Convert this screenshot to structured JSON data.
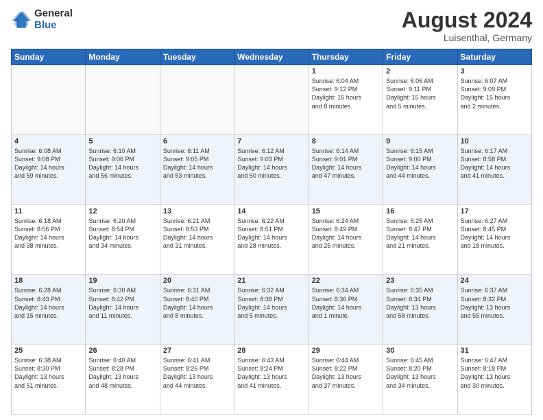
{
  "logo": {
    "general": "General",
    "blue": "Blue"
  },
  "title": "August 2024",
  "location": "Luisenthal, Germany",
  "days_header": [
    "Sunday",
    "Monday",
    "Tuesday",
    "Wednesday",
    "Thursday",
    "Friday",
    "Saturday"
  ],
  "weeks": [
    [
      {
        "day": "",
        "info": ""
      },
      {
        "day": "",
        "info": ""
      },
      {
        "day": "",
        "info": ""
      },
      {
        "day": "",
        "info": ""
      },
      {
        "day": "1",
        "info": "Sunrise: 6:04 AM\nSunset: 9:12 PM\nDaylight: 15 hours\nand 8 minutes."
      },
      {
        "day": "2",
        "info": "Sunrise: 6:06 AM\nSunset: 9:11 PM\nDaylight: 15 hours\nand 5 minutes."
      },
      {
        "day": "3",
        "info": "Sunrise: 6:07 AM\nSunset: 9:09 PM\nDaylight: 15 hours\nand 2 minutes."
      }
    ],
    [
      {
        "day": "4",
        "info": "Sunrise: 6:08 AM\nSunset: 9:08 PM\nDaylight: 14 hours\nand 59 minutes."
      },
      {
        "day": "5",
        "info": "Sunrise: 6:10 AM\nSunset: 9:06 PM\nDaylight: 14 hours\nand 56 minutes."
      },
      {
        "day": "6",
        "info": "Sunrise: 6:11 AM\nSunset: 9:05 PM\nDaylight: 14 hours\nand 53 minutes."
      },
      {
        "day": "7",
        "info": "Sunrise: 6:12 AM\nSunset: 9:03 PM\nDaylight: 14 hours\nand 50 minutes."
      },
      {
        "day": "8",
        "info": "Sunrise: 6:14 AM\nSunset: 9:01 PM\nDaylight: 14 hours\nand 47 minutes."
      },
      {
        "day": "9",
        "info": "Sunrise: 6:15 AM\nSunset: 9:00 PM\nDaylight: 14 hours\nand 44 minutes."
      },
      {
        "day": "10",
        "info": "Sunrise: 6:17 AM\nSunset: 8:58 PM\nDaylight: 14 hours\nand 41 minutes."
      }
    ],
    [
      {
        "day": "11",
        "info": "Sunrise: 6:18 AM\nSunset: 8:56 PM\nDaylight: 14 hours\nand 38 minutes."
      },
      {
        "day": "12",
        "info": "Sunrise: 6:20 AM\nSunset: 8:54 PM\nDaylight: 14 hours\nand 34 minutes."
      },
      {
        "day": "13",
        "info": "Sunrise: 6:21 AM\nSunset: 8:53 PM\nDaylight: 14 hours\nand 31 minutes."
      },
      {
        "day": "14",
        "info": "Sunrise: 6:22 AM\nSunset: 8:51 PM\nDaylight: 14 hours\nand 28 minutes."
      },
      {
        "day": "15",
        "info": "Sunrise: 6:24 AM\nSunset: 8:49 PM\nDaylight: 14 hours\nand 25 minutes."
      },
      {
        "day": "16",
        "info": "Sunrise: 6:25 AM\nSunset: 8:47 PM\nDaylight: 14 hours\nand 21 minutes."
      },
      {
        "day": "17",
        "info": "Sunrise: 6:27 AM\nSunset: 8:45 PM\nDaylight: 14 hours\nand 18 minutes."
      }
    ],
    [
      {
        "day": "18",
        "info": "Sunrise: 6:28 AM\nSunset: 8:43 PM\nDaylight: 14 hours\nand 15 minutes."
      },
      {
        "day": "19",
        "info": "Sunrise: 6:30 AM\nSunset: 8:42 PM\nDaylight: 14 hours\nand 11 minutes."
      },
      {
        "day": "20",
        "info": "Sunrise: 6:31 AM\nSunset: 8:40 PM\nDaylight: 14 hours\nand 8 minutes."
      },
      {
        "day": "21",
        "info": "Sunrise: 6:32 AM\nSunset: 8:38 PM\nDaylight: 14 hours\nand 5 minutes."
      },
      {
        "day": "22",
        "info": "Sunrise: 6:34 AM\nSunset: 8:36 PM\nDaylight: 14 hours\nand 1 minute."
      },
      {
        "day": "23",
        "info": "Sunrise: 6:35 AM\nSunset: 8:34 PM\nDaylight: 13 hours\nand 58 minutes."
      },
      {
        "day": "24",
        "info": "Sunrise: 6:37 AM\nSunset: 8:32 PM\nDaylight: 13 hours\nand 55 minutes."
      }
    ],
    [
      {
        "day": "25",
        "info": "Sunrise: 6:38 AM\nSunset: 8:30 PM\nDaylight: 13 hours\nand 51 minutes."
      },
      {
        "day": "26",
        "info": "Sunrise: 6:40 AM\nSunset: 8:28 PM\nDaylight: 13 hours\nand 48 minutes."
      },
      {
        "day": "27",
        "info": "Sunrise: 6:41 AM\nSunset: 8:26 PM\nDaylight: 13 hours\nand 44 minutes."
      },
      {
        "day": "28",
        "info": "Sunrise: 6:43 AM\nSunset: 8:24 PM\nDaylight: 13 hours\nand 41 minutes."
      },
      {
        "day": "29",
        "info": "Sunrise: 6:44 AM\nSunset: 8:22 PM\nDaylight: 13 hours\nand 37 minutes."
      },
      {
        "day": "30",
        "info": "Sunrise: 6:45 AM\nSunset: 8:20 PM\nDaylight: 13 hours\nand 34 minutes."
      },
      {
        "day": "31",
        "info": "Sunrise: 6:47 AM\nSunset: 8:18 PM\nDaylight: 13 hours\nand 30 minutes."
      }
    ]
  ]
}
